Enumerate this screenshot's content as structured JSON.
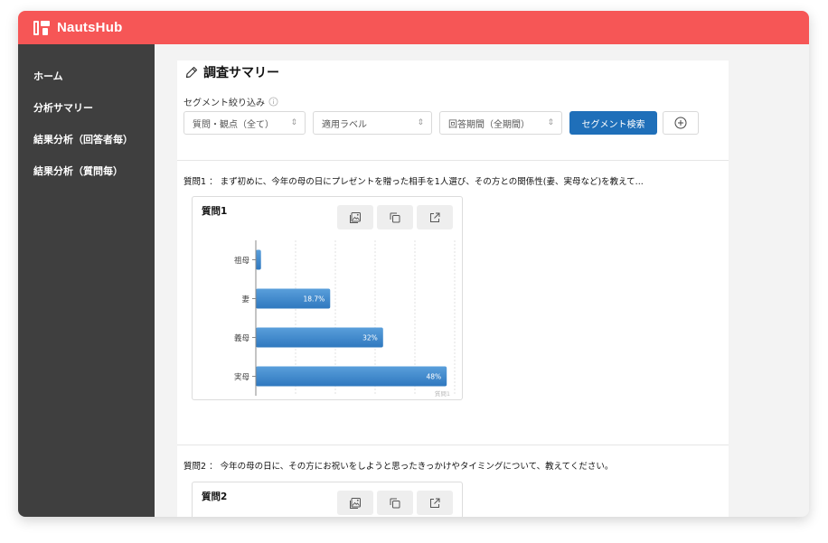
{
  "app": {
    "name": "NautsHub",
    "brand_color": "#f65656"
  },
  "sidebar": {
    "items": [
      {
        "label": "ホーム"
      },
      {
        "label": "分析サマリー"
      },
      {
        "label": "結果分析（回答者毎）"
      },
      {
        "label": "結果分析（質問毎）"
      }
    ]
  },
  "page": {
    "title": "調査サマリー",
    "title_icon": "pen-icon"
  },
  "segment": {
    "label": "セグメント絞り込み",
    "filters": [
      {
        "value": "質問・観点（全て）"
      },
      {
        "value": "適用ラベル"
      },
      {
        "value": "回答期間（全期間）"
      }
    ],
    "search_button": "セグメント検索",
    "accent_color": "#1f6fb9"
  },
  "questions": [
    {
      "text": "質問1 ： まず初めに、今年の母の日にプレゼントを贈った相手を1人選び、その方との関係性(妻、実母など)を教えて...",
      "card_title": "質問1",
      "footer_label": "質問1"
    },
    {
      "text": "質問2 ： 今年の母の日に、その方にお祝いをしようと思ったきっかけやタイミングについて、教えてください。",
      "card_title": "質問2"
    }
  ],
  "chart_data": {
    "type": "bar",
    "orientation": "horizontal",
    "categories": [
      "祖母",
      "妻",
      "義母",
      "実母"
    ],
    "values": [
      1.3,
      18.7,
      32,
      48
    ],
    "data_labels": [
      "",
      "18.7%",
      "32%",
      "48%"
    ],
    "xlim": [
      0,
      50
    ],
    "grid": true,
    "bar_color": "#3b86cc"
  }
}
